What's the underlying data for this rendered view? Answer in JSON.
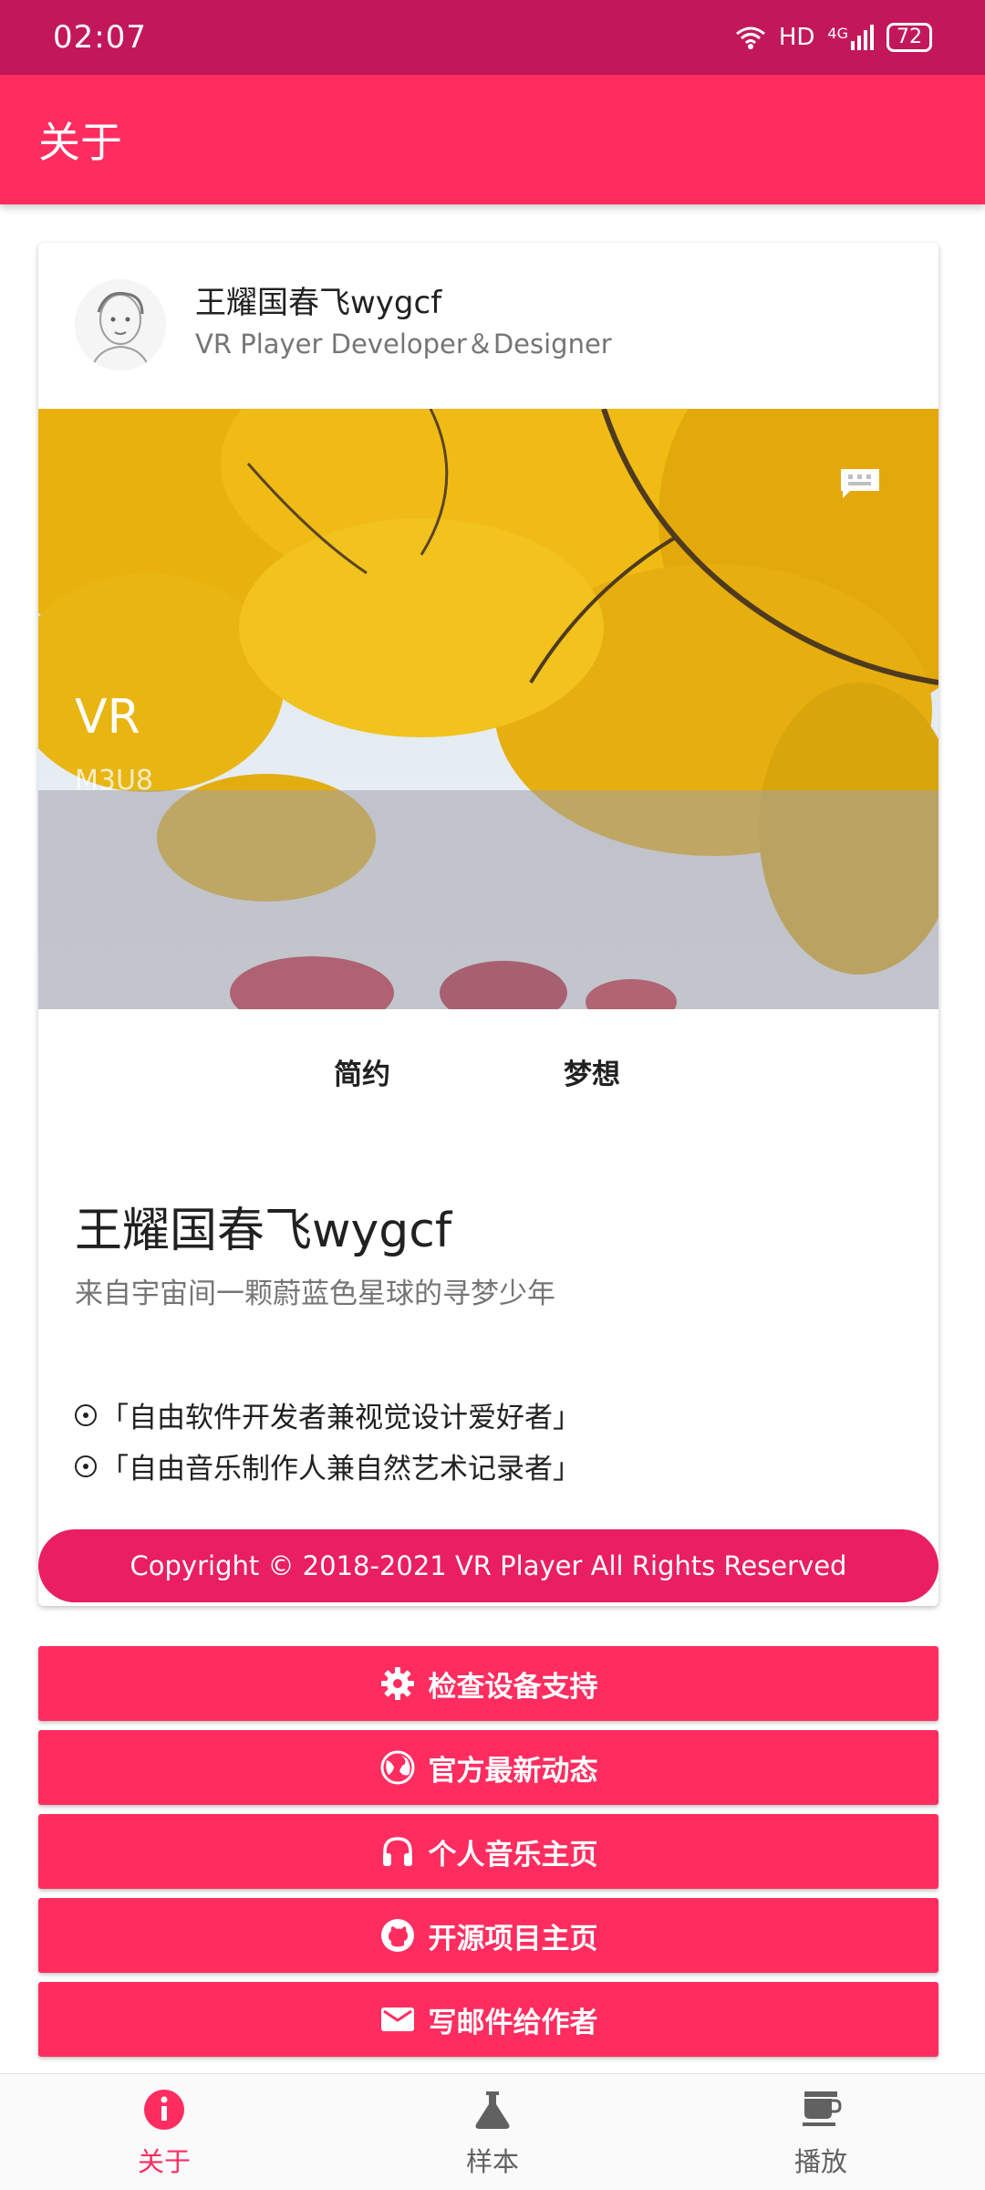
{
  "status_bar": {
    "time": "02:07",
    "network": "HD",
    "signal": "4G",
    "battery": "72"
  },
  "app_bar": {
    "title": "关于"
  },
  "profile": {
    "name": "王耀国春飞wygcf",
    "role": "VR Player Developer＆Designer"
  },
  "banner": {
    "title": "VR",
    "subtitle": "M3U8"
  },
  "tabs": [
    "简约",
    "梦想"
  ],
  "about": {
    "name": "王耀国春飞wygcf",
    "tagline": "来自宇宙间一颗蔚蓝色星球的寻梦少年",
    "bullets": [
      "「自由软件开发者兼视觉设计爱好者」",
      "「自由音乐制作人兼自然艺术记录者」"
    ]
  },
  "copyright": "Copyright © 2018-2021 VR Player All Rights Reserved",
  "actions": [
    {
      "label": "检查设备支持",
      "icon": "gear-icon"
    },
    {
      "label": "官方最新动态",
      "icon": "globe-icon"
    },
    {
      "label": "个人音乐主页",
      "icon": "headphones-icon"
    },
    {
      "label": "开源项目主页",
      "icon": "github-icon"
    },
    {
      "label": "写邮件给作者",
      "icon": "mail-icon"
    }
  ],
  "bottom_nav": [
    {
      "label": "关于",
      "icon": "info-icon",
      "active": true
    },
    {
      "label": "样本",
      "icon": "flask-icon",
      "active": false
    },
    {
      "label": "播放",
      "icon": "coffee-cup-icon",
      "active": false
    }
  ],
  "colors": {
    "status_bar": "#c2185b",
    "primary": "#ff2d5f",
    "pill": "#e91e63"
  }
}
